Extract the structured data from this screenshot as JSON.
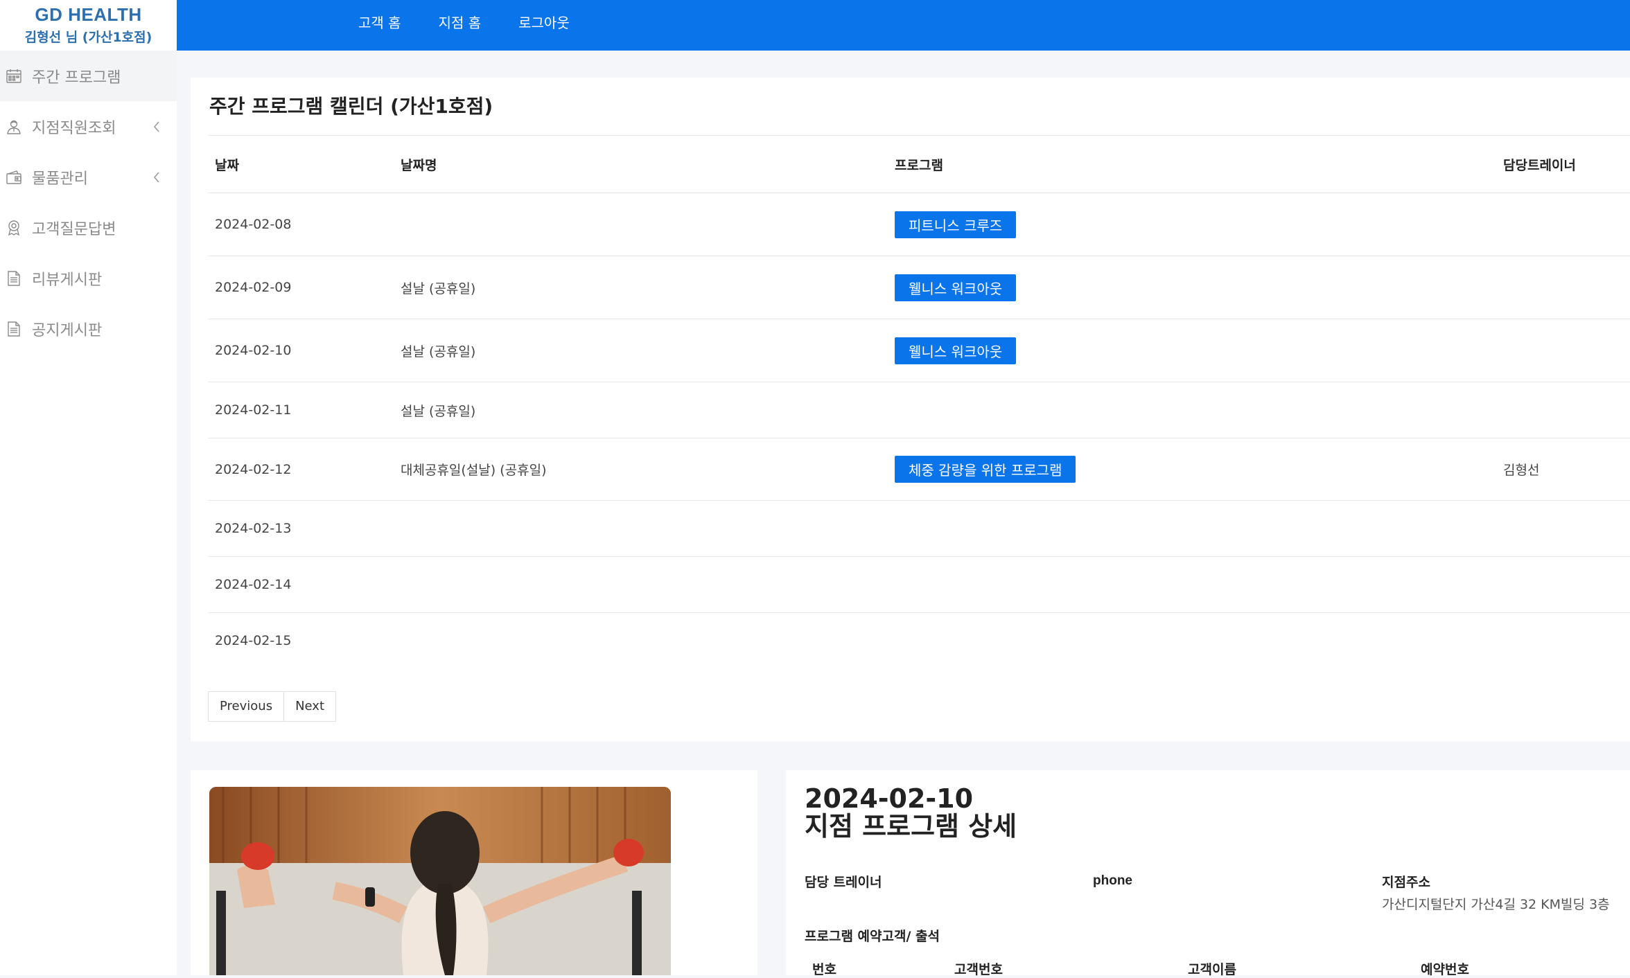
{
  "brand": {
    "title": "GD HEALTH",
    "user": "김형선 님 (가산1호점)"
  },
  "sidebar": {
    "items": [
      {
        "label": "주간 프로그램",
        "icon": "calendar-icon",
        "active": true,
        "submenu": false
      },
      {
        "label": "지점직원조회",
        "icon": "staff-icon",
        "active": false,
        "submenu": true
      },
      {
        "label": "물품관리",
        "icon": "wallet-icon",
        "active": false,
        "submenu": true
      },
      {
        "label": "고객질문답변",
        "icon": "badge-icon",
        "active": false,
        "submenu": false
      },
      {
        "label": "리뷰게시판",
        "icon": "document-icon",
        "active": false,
        "submenu": false
      },
      {
        "label": "공지게시판",
        "icon": "document-icon",
        "active": false,
        "submenu": false
      }
    ]
  },
  "topnav": {
    "links": [
      "고객 홈",
      "지점 홈",
      "로그아웃"
    ]
  },
  "calendar": {
    "title": "주간 프로그램 캘린더 (가산1호점)",
    "columns": [
      "날짜",
      "날짜명",
      "프로그램",
      "담당트레이너"
    ],
    "rows": [
      {
        "date": "2024-02-08",
        "name": "",
        "program": "피트니스 크루즈",
        "trainer": ""
      },
      {
        "date": "2024-02-09",
        "name": "설날 (공휴일)",
        "program": "웰니스 워크아웃",
        "trainer": ""
      },
      {
        "date": "2024-02-10",
        "name": "설날 (공휴일)",
        "program": "웰니스 워크아웃",
        "trainer": ""
      },
      {
        "date": "2024-02-11",
        "name": "설날 (공휴일)",
        "program": "",
        "trainer": ""
      },
      {
        "date": "2024-02-12",
        "name": "대체공휴일(설날) (공휴일)",
        "program": "체중 감량을 위한 프로그램",
        "trainer": "김형선"
      },
      {
        "date": "2024-02-13",
        "name": "",
        "program": "",
        "trainer": ""
      },
      {
        "date": "2024-02-14",
        "name": "",
        "program": "",
        "trainer": ""
      },
      {
        "date": "2024-02-15",
        "name": "",
        "program": "",
        "trainer": ""
      }
    ],
    "pager": {
      "previous": "Previous",
      "next": "Next"
    }
  },
  "detail": {
    "date": "2024-02-10",
    "title": "지점 프로그램 상세",
    "trainer_label": "담당 트레이너",
    "phone_label": "phone",
    "address_label": "지점주소",
    "address_value": "가산디지털단지 가산4길 32 KM빌딩 3층",
    "reservation_label": "프로그램 예약고객/ 출석",
    "reservation_columns": [
      "번호",
      "고객번호",
      "고객이름",
      "예약번호"
    ]
  },
  "colors": {
    "primary": "#0a74ea",
    "brand": "#2b6fb0",
    "sidebar_text": "#8a8a8a",
    "page_bg": "#f4f6f9"
  }
}
